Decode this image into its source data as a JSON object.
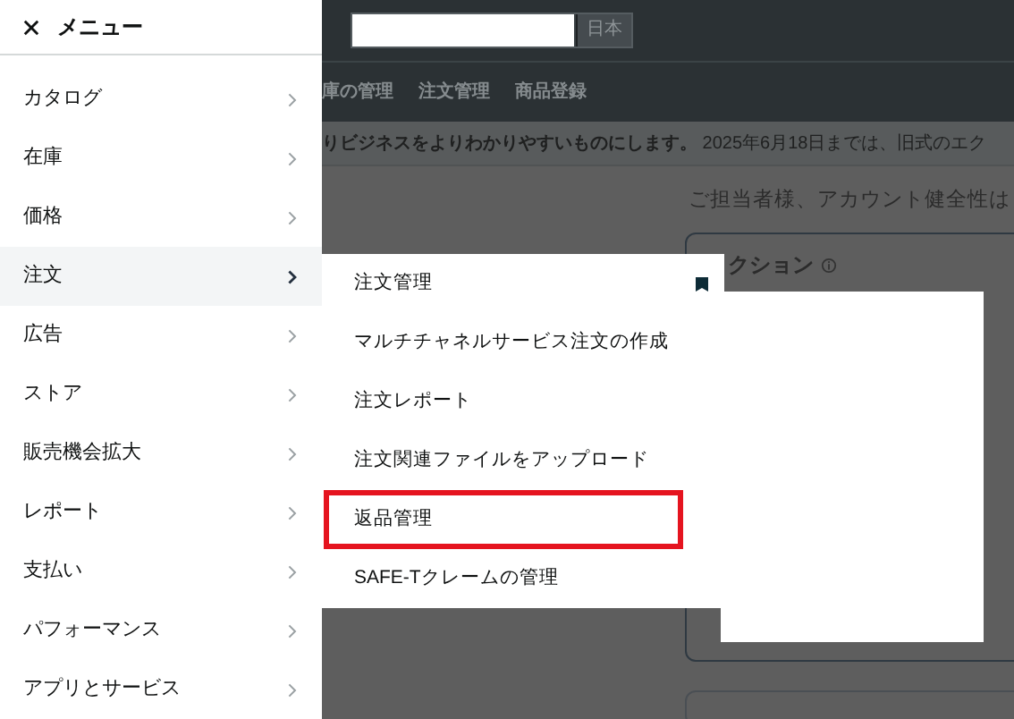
{
  "header": {
    "search_button": "日本",
    "nav": [
      "庫の管理",
      "注文管理",
      "商品登録"
    ]
  },
  "banner": {
    "text": "**りビジネスをよりわかりやすいものにします。** 2025年6月18日までは、旧式のエク"
  },
  "main": {
    "greeting": "ご担当者様、アカウント健全性は",
    "card_title": "クション"
  },
  "menu": {
    "title": "メニュー",
    "items": [
      {
        "label": "カタログ",
        "selected": false
      },
      {
        "label": "在庫",
        "selected": false
      },
      {
        "label": "価格",
        "selected": false
      },
      {
        "label": "注文",
        "selected": true
      },
      {
        "label": "広告",
        "selected": false
      },
      {
        "label": "ストア",
        "selected": false
      },
      {
        "label": "販売機会拡大",
        "selected": false
      },
      {
        "label": "レポート",
        "selected": false
      },
      {
        "label": "支払い",
        "selected": false
      },
      {
        "label": "パフォーマンス",
        "selected": false
      },
      {
        "label": "アプリとサービス",
        "selected": false
      }
    ]
  },
  "submenu": {
    "items": [
      {
        "label": "注文管理",
        "bookmarked": true,
        "highlighted": false
      },
      {
        "label": "マルチチャネルサービス注文の作成",
        "bookmarked": false,
        "highlighted": false
      },
      {
        "label": "注文レポート",
        "bookmarked": false,
        "highlighted": false
      },
      {
        "label": "注文関連ファイルをアップロード",
        "bookmarked": false,
        "highlighted": false
      },
      {
        "label": "返品管理",
        "bookmarked": false,
        "highlighted": true
      },
      {
        "label": "SAFE-Tクレームの管理",
        "bookmarked": false,
        "highlighted": false
      }
    ]
  }
}
